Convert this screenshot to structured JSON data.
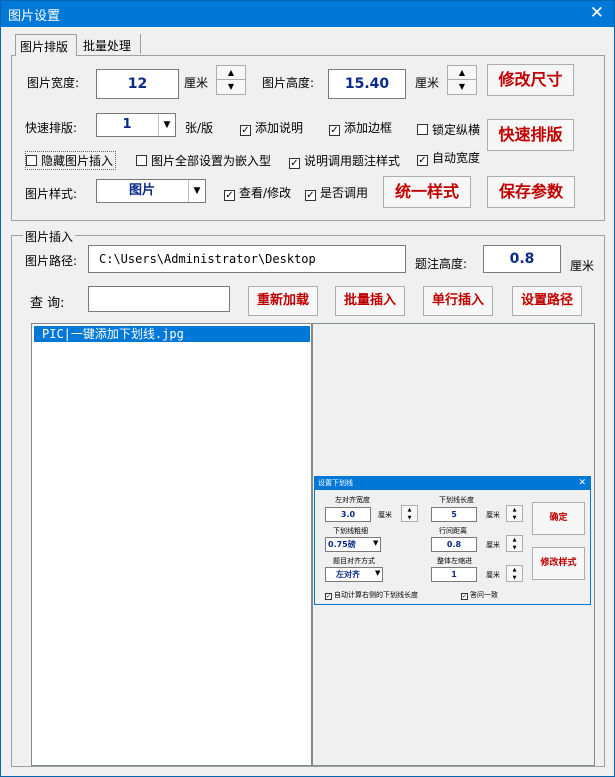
{
  "window": {
    "title": "图片设置",
    "close_glyph": "✕"
  },
  "tabs": [
    {
      "label": "图片排版"
    },
    {
      "label": "批量处理"
    }
  ],
  "layout_section": {
    "width_label": "图片宽度:",
    "width_value": "12",
    "width_unit": "厘米",
    "height_label": "图片高度:",
    "height_value": "15.40",
    "height_unit": "厘米",
    "resize_button": "修改尺寸",
    "quick_layout_label": "快速排版:",
    "quick_layout_value": "1",
    "quick_layout_unit": "张/版",
    "add_caption": {
      "label": "添加说明",
      "checked": true
    },
    "add_border": {
      "label": "添加边框",
      "checked": true
    },
    "lock_aspect": {
      "label": "锁定纵横",
      "checked": false
    },
    "quick_layout_button": "快速排版",
    "hide_insert": {
      "label": "隐藏图片插入",
      "checked": false
    },
    "all_inline": {
      "label": "图片全部设置为嵌入型",
      "checked": false
    },
    "caption_style": {
      "label": "说明调用题注样式",
      "checked": true
    },
    "auto_width": {
      "label": "自动宽度",
      "checked": true
    },
    "style_label": "图片样式:",
    "style_value": "图片",
    "view_edit": {
      "label": "查看/修改",
      "checked": true
    },
    "use_style": {
      "label": "是否调用",
      "checked": true
    },
    "unify_button": "统一样式",
    "save_button": "保存参数"
  },
  "insert_section": {
    "group_title": "图片插入",
    "path_label": "图片路径:",
    "path_value": "C:\\Users\\Administrator\\Desktop",
    "caption_height_label": "题注高度:",
    "caption_height_value": "0.8",
    "caption_height_unit": "厘米",
    "search_label": "查  询:",
    "search_value": "",
    "buttons": {
      "reload": "重新加载",
      "batch_insert": "批量插入",
      "row_insert": "单行插入",
      "set_path": "设置路径"
    },
    "files": [
      "PIC|一键添加下划线.jpg"
    ]
  },
  "preview_dialog": {
    "title": "设置下划线",
    "close_glyph": "✕",
    "f1_label": "左对齐宽度",
    "f1_value": "3.0",
    "f1_unit": "厘米",
    "f2_label": "下划线长度",
    "f2_value": "5",
    "f2_unit": "厘米",
    "f3_label": "下划线粗细",
    "f3_value": "0.75磅",
    "f4_label": "行间距离",
    "f4_value": "0.8",
    "f4_unit": "厘米",
    "f5_label": "题目对齐方式",
    "f5_value": "左对齐",
    "f6_label": "整体左缩进",
    "f6_value": "1",
    "f6_unit": "厘米",
    "ok_button": "确定",
    "modify_button": "修改样式",
    "chk1": "自动计算右侧的下划线长度",
    "chk2": "答问一致"
  },
  "colors": {
    "titlebar": "#0078d7",
    "value_text": "#0a2a8a",
    "button_text": "#c00000",
    "selection": "#0078d7"
  }
}
